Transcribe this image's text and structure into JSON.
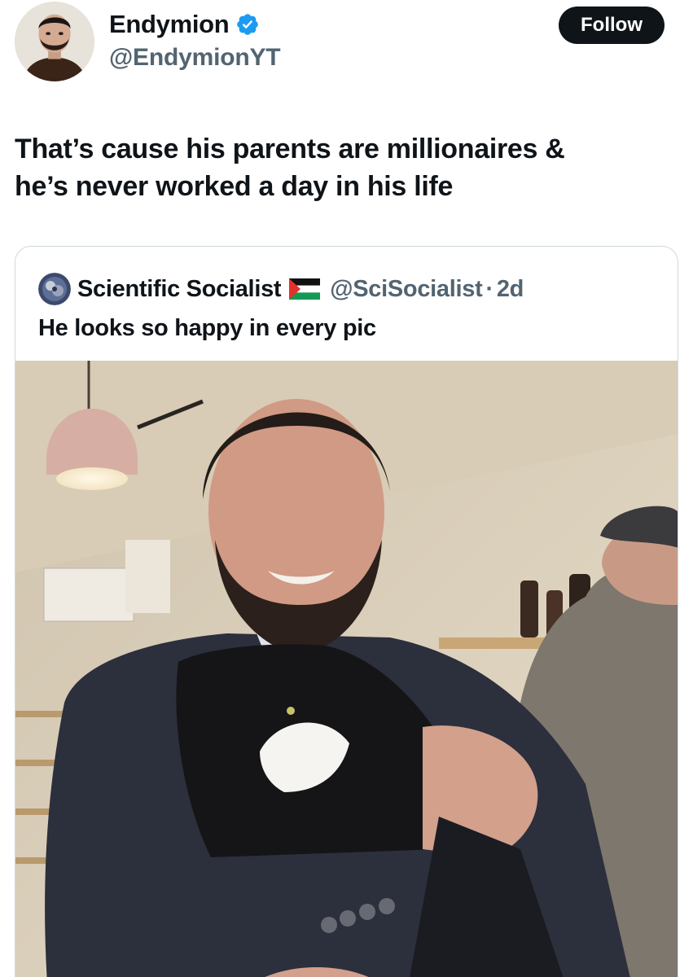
{
  "author": {
    "display_name": "Endymion",
    "handle": "@EndymionYT",
    "verified_icon": "verified-badge-icon",
    "avatar": "profile-avatar"
  },
  "follow_label": "Follow",
  "tweet": {
    "text_line1": "That’s cause his parents are millionaires &",
    "text_line2": "he’s never worked a day in his life"
  },
  "quote": {
    "display_name": "Scientific Socialist",
    "flag_icon": "palestine-flag-icon",
    "handle": "@SciSocialist",
    "separator": "·",
    "time": "2d",
    "text": "He looks so happy in every pic",
    "media": "photo"
  },
  "colors": {
    "text_primary": "#0f1419",
    "text_secondary": "#536471",
    "verified_blue": "#1d9bf0",
    "follow_bg": "#0f1419",
    "border": "#cfd9de"
  }
}
